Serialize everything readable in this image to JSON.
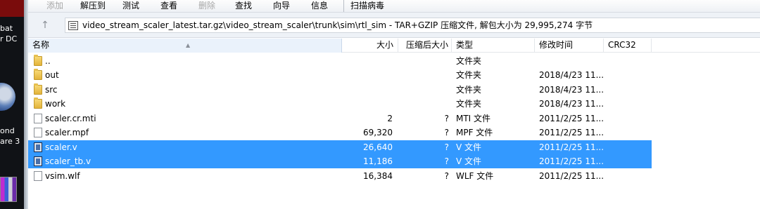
{
  "desktop": {
    "labels": [
      "bat",
      "r DC",
      "ond",
      "are 3"
    ]
  },
  "toolbar": {
    "items": [
      "添加",
      "解压到",
      "测试",
      "查看",
      "删除",
      "查找",
      "向导",
      "信息",
      "扫描病毒"
    ]
  },
  "address": {
    "up_icon": "up-arrow-icon",
    "path": "video_stream_scaler_latest.tar.gz\\video_stream_scaler\\trunk\\sim\\rtl_sim - TAR+GZIP 压缩文件, 解包大小为 29,995,274 字节"
  },
  "columns": {
    "name": "名称",
    "size": "大小",
    "packed": "压缩后大小",
    "type": "类型",
    "modified": "修改时间",
    "crc": "CRC32"
  },
  "files": [
    {
      "icon": "folder-icon",
      "name": "..",
      "size": "",
      "packed": "",
      "type": "文件夹",
      "modified": ""
    },
    {
      "icon": "folder-icon",
      "name": "out",
      "size": "",
      "packed": "",
      "type": "文件夹",
      "modified": "2018/4/23 11..."
    },
    {
      "icon": "folder-icon",
      "name": "src",
      "size": "",
      "packed": "",
      "type": "文件夹",
      "modified": "2018/4/23 11..."
    },
    {
      "icon": "folder-icon",
      "name": "work",
      "size": "",
      "packed": "",
      "type": "文件夹",
      "modified": "2018/4/23 11..."
    },
    {
      "icon": "document-icon",
      "name": "scaler.cr.mti",
      "size": "2",
      "packed": "?",
      "type": "MTI 文件",
      "modified": "2011/2/25 11..."
    },
    {
      "icon": "document-icon",
      "name": "scaler.mpf",
      "size": "69,320",
      "packed": "?",
      "type": "MPF 文件",
      "modified": "2011/2/25 11..."
    },
    {
      "icon": "verilog-file-icon",
      "name": "scaler.v",
      "size": "26,640",
      "packed": "?",
      "type": "V 文件",
      "modified": "2011/2/25 11...",
      "selected": true
    },
    {
      "icon": "verilog-file-icon",
      "name": "scaler_tb.v",
      "size": "11,186",
      "packed": "?",
      "type": "V 文件",
      "modified": "2011/2/25 11...",
      "selected": true
    },
    {
      "icon": "document-icon",
      "name": "vsim.wlf",
      "size": "16,384",
      "packed": "?",
      "type": "WLF 文件",
      "modified": "2011/2/25 11..."
    }
  ],
  "colors": {
    "selection": "#3399ff",
    "folder": "#e3b33a"
  }
}
